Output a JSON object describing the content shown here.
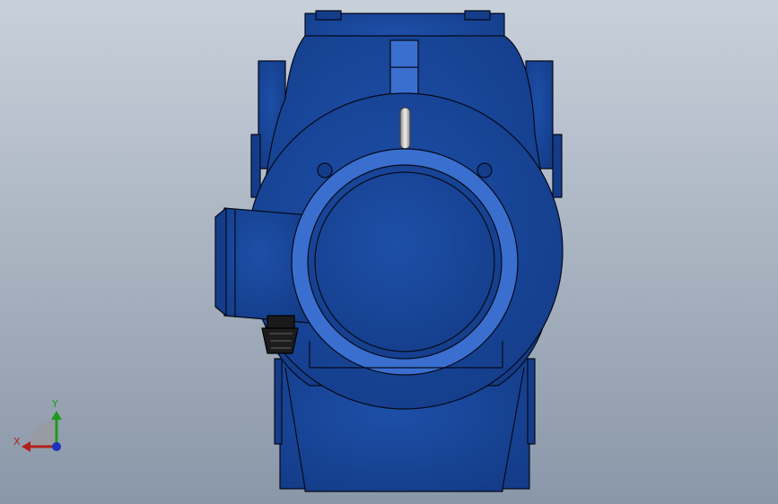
{
  "viewport": {
    "background_top": "#c8d0da",
    "background_bottom": "#8a97a8"
  },
  "model": {
    "body_color": "#1d4fa8",
    "body_color_dark": "#143c88",
    "body_color_light": "#3a6fd0",
    "edge_color": "#050a1a",
    "gland_color": "#1a1a1a",
    "handle_color": "#c8c8c8"
  },
  "triad": {
    "x_label": "X",
    "y_label": "Y",
    "x_color": "#b3201c",
    "y_color": "#1e9a1e",
    "z_color": "#1a33c0"
  }
}
